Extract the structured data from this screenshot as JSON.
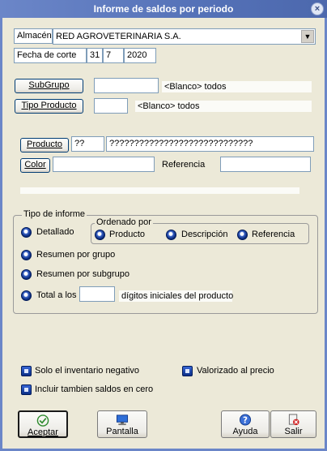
{
  "window": {
    "title": "Informe de saldos por periodo",
    "close_icon": "close-icon"
  },
  "almacen": {
    "label": "Almacén",
    "value": "RED AGROVETERINARIA S.A."
  },
  "fecha": {
    "label": "Fecha de corte",
    "day": "31",
    "month": "7",
    "year": "2020"
  },
  "subgrupo": {
    "button": "SubGrupo",
    "value": "",
    "hint": "<Blanco> todos"
  },
  "tipo_producto": {
    "button": "Tipo Producto",
    "value": "",
    "hint": "<Blanco> todos"
  },
  "producto": {
    "button": "Producto",
    "code": "??",
    "description": "?????????????????????????????"
  },
  "color": {
    "button": "Color",
    "value": "",
    "referencia_label": "Referencia",
    "referencia_value": ""
  },
  "tipo_informe": {
    "title": "Tipo de informe",
    "detallado": "Detallado",
    "ordenado_por": {
      "title": "Ordenado por",
      "producto": "Producto",
      "descripcion": "Descripción",
      "referencia": "Referencia"
    },
    "resumen_grupo": "Resumen por grupo",
    "resumen_subgrupo": "Resumen por subgrupo",
    "total_prefix": "Total a los",
    "total_digits": "",
    "total_suffix": "dígitos iniciales del producto"
  },
  "options": {
    "solo_negativo": "Solo el inventario negativo",
    "valorizado": "Valorizado al precio",
    "incluir_cero": "Incluir tambien saldos en cero"
  },
  "buttons": {
    "aceptar": "Aceptar",
    "pantalla": "Pantalla",
    "ayuda": "Ayuda",
    "salir": "Salir"
  },
  "colors": {
    "titlebar": "#5572b8",
    "background": "#ece9d8",
    "accent": "#0b2f86"
  }
}
